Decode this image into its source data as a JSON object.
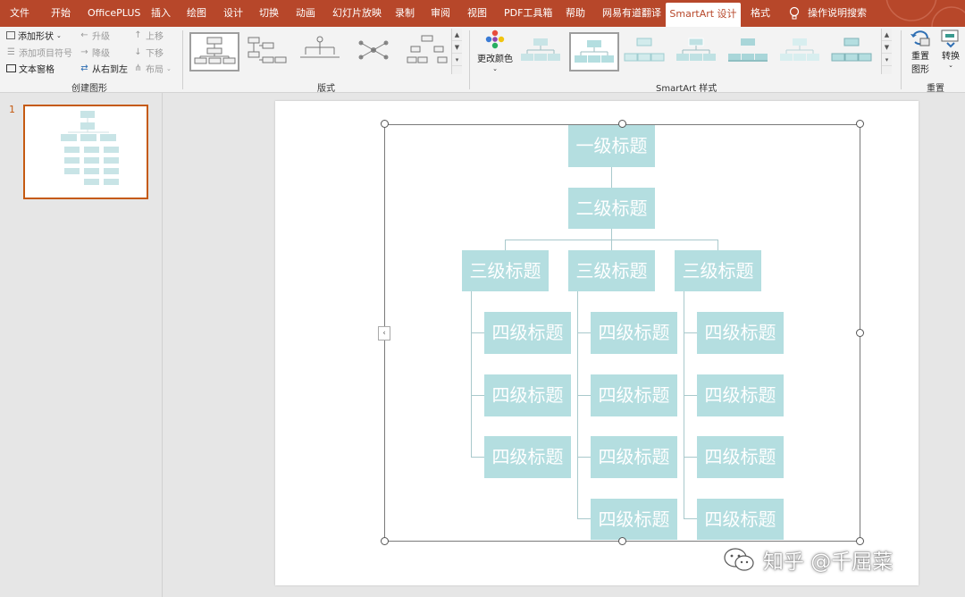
{
  "tabs": [
    "文件",
    "开始",
    "OfficePLUS",
    "插入",
    "绘图",
    "设计",
    "切换",
    "动画",
    "幻灯片放映",
    "录制",
    "审阅",
    "视图",
    "PDF工具箱",
    "帮助",
    "网易有道翻译",
    "SmartArt 设计",
    "格式"
  ],
  "tell_me": "操作说明搜索",
  "ribbon": {
    "create": {
      "add_shape": "添加形状",
      "add_bullet": "添加项目符号",
      "text_pane": "文本窗格",
      "promote": "升级",
      "demote": "降级",
      "rtl": "从右到左",
      "move_up": "上移",
      "move_down": "下移",
      "layout": "布局",
      "label": "创建图形"
    },
    "layouts_label": "版式",
    "change_colors": "更改颜色",
    "styles_label": "SmartArt 样式",
    "reset_graphic_1": "重置",
    "reset_graphic_2": "图形",
    "convert": "转换",
    "reset_label": "重置"
  },
  "slide_number": "1",
  "colors": {
    "accent": "#b7472a",
    "node_fill": "#b4dee0",
    "line": "#a9c9cc"
  },
  "diagram": {
    "level1": "一级标题",
    "level2": "二级标题",
    "level3": [
      "三级标题",
      "三级标题",
      "三级标题"
    ],
    "level4": [
      [
        "四级标题",
        "四级标题",
        "四级标题"
      ],
      [
        "四级标题",
        "四级标题",
        "四级标题",
        "四级标题"
      ],
      [
        "四级标题",
        "四级标题",
        "四级标题",
        "四级标题"
      ]
    ]
  },
  "watermark": "知乎 @千屈菜"
}
